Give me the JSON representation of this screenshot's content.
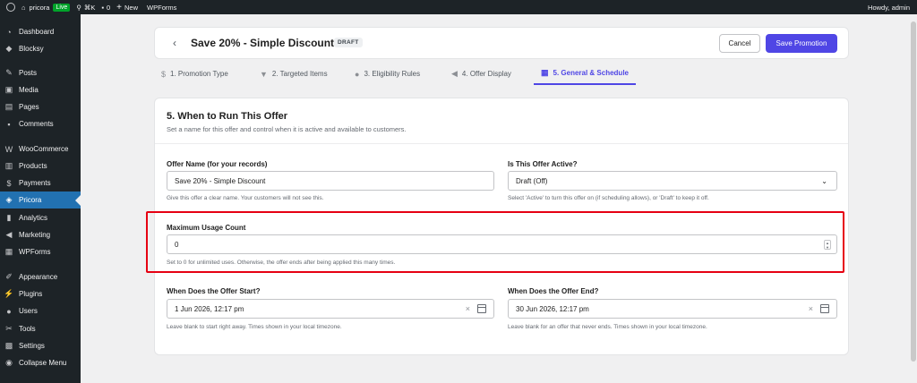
{
  "adminbar": {
    "site_name": "pricora",
    "live_badge": "Live",
    "shortcut": "⌘K",
    "comments_count": "0",
    "new_label": "New",
    "wpforms_label": "WPForms",
    "howdy": "Howdy, admin"
  },
  "sidebar": {
    "items": [
      {
        "label": "Dashboard",
        "icon": "dashboard-icon"
      },
      {
        "label": "Blocksy",
        "icon": "blocksy-icon"
      },
      {
        "label": "Posts",
        "icon": "pin-icon"
      },
      {
        "label": "Media",
        "icon": "media-icon"
      },
      {
        "label": "Pages",
        "icon": "pages-icon"
      },
      {
        "label": "Comments",
        "icon": "comment-icon"
      },
      {
        "label": "WooCommerce",
        "icon": "woo-icon"
      },
      {
        "label": "Products",
        "icon": "products-icon"
      },
      {
        "label": "Payments",
        "icon": "payments-icon"
      },
      {
        "label": "Pricora",
        "icon": "pricora-icon"
      },
      {
        "label": "Analytics",
        "icon": "analytics-icon"
      },
      {
        "label": "Marketing",
        "icon": "megaphone-icon"
      },
      {
        "label": "WPForms",
        "icon": "wpforms-icon"
      },
      {
        "label": "Appearance",
        "icon": "brush-icon"
      },
      {
        "label": "Plugins",
        "icon": "plugin-icon"
      },
      {
        "label": "Users",
        "icon": "users-icon"
      },
      {
        "label": "Tools",
        "icon": "wrench-icon"
      },
      {
        "label": "Settings",
        "icon": "settings-icon"
      },
      {
        "label": "Collapse Menu",
        "icon": "collapse-icon"
      }
    ],
    "active_label": "Pricora"
  },
  "header": {
    "title": "Save 20% - Simple Discount",
    "status_badge": "DRAFT",
    "cancel_label": "Cancel",
    "save_label": "Save Promotion"
  },
  "tabs": [
    {
      "label": "1. Promotion Type"
    },
    {
      "label": "2. Targeted Items"
    },
    {
      "label": "3. Eligibility Rules"
    },
    {
      "label": "4. Offer Display"
    },
    {
      "label": "5. General & Schedule"
    }
  ],
  "active_tab": "5. General & Schedule",
  "section": {
    "title": "5. When to Run This Offer",
    "subtitle": "Set a name for this offer and control when it is active and available to customers."
  },
  "fields": {
    "offer_name": {
      "label": "Offer Name (for your records)",
      "value": "Save 20% - Simple Discount",
      "help": "Give this offer a clear name. Your customers will not see this."
    },
    "active": {
      "label": "Is This Offer Active?",
      "value": "Draft (Off)",
      "help": "Select 'Active' to turn this offer on (if scheduling allows), or 'Draft' to keep it off."
    },
    "max_usage": {
      "label": "Maximum Usage Count",
      "value": "0",
      "help": "Set to 0 for unlimited uses. Otherwise, the offer ends after being applied this many times."
    },
    "start": {
      "label": "When Does the Offer Start?",
      "value": "1 Jun 2026, 12:17 pm",
      "help": "Leave blank to start right away. Times shown in your local timezone."
    },
    "end": {
      "label": "When Does the Offer End?",
      "value": "30 Jun 2026, 12:17 pm",
      "help": "Leave blank for an offer that never ends. Times shown in your local timezone."
    }
  },
  "colors": {
    "accent": "#4f46e5",
    "highlight": "#e60012",
    "admin_dark": "#1d2327",
    "wp_blue": "#2271b1"
  }
}
